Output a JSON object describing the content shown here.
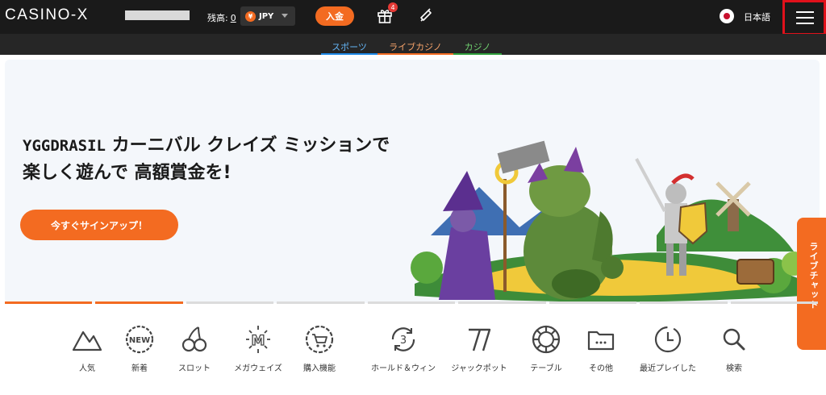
{
  "header": {
    "logo": "CASINO-X",
    "balance_label": "残高:",
    "balance_value": "0",
    "currency": "JPY",
    "currency_symbol": "¥",
    "deposit_label": "入金",
    "gift_badge": "4",
    "language": "日本語"
  },
  "subnav": {
    "tabs": [
      {
        "label": "スポーツ",
        "color": "#1e88e5"
      },
      {
        "label": "ライブカジノ",
        "color": "#f36b21"
      },
      {
        "label": "カジノ",
        "color": "#2e9e3a"
      }
    ],
    "active": "カジノ"
  },
  "hero": {
    "brand": "YGGDRASIL",
    "title_line1": "カーニバル クレイズ ミッションで",
    "title_line2": "楽しく遊んで 高額賞金を!",
    "cta": "今すぐサインアップ！"
  },
  "live_chat": "ライブチャット",
  "slider": {
    "segments": 9,
    "active_segments": 2
  },
  "categories": [
    {
      "label": "人気",
      "icon": "mountain-icon"
    },
    {
      "label": "新着",
      "icon": "new-badge-icon"
    },
    {
      "label": "スロット",
      "icon": "cherry-icon"
    },
    {
      "label": "メガウェイズ",
      "icon": "megaways-icon"
    },
    {
      "label": "購入機能",
      "icon": "cart-icon"
    },
    {
      "label": "ホールド＆ウィン",
      "icon": "hold-win-icon"
    },
    {
      "label": "ジャックポット",
      "icon": "seven-icon"
    },
    {
      "label": "テーブル",
      "icon": "chip-icon"
    },
    {
      "label": "その他",
      "icon": "folder-icon"
    },
    {
      "label": "最近プレイした",
      "icon": "clock-icon"
    },
    {
      "label": "検索",
      "icon": "search-icon"
    }
  ],
  "colors": {
    "accent": "#f36b21",
    "topbar": "#1a1a1a",
    "menu_highlight": "#e0111b"
  }
}
